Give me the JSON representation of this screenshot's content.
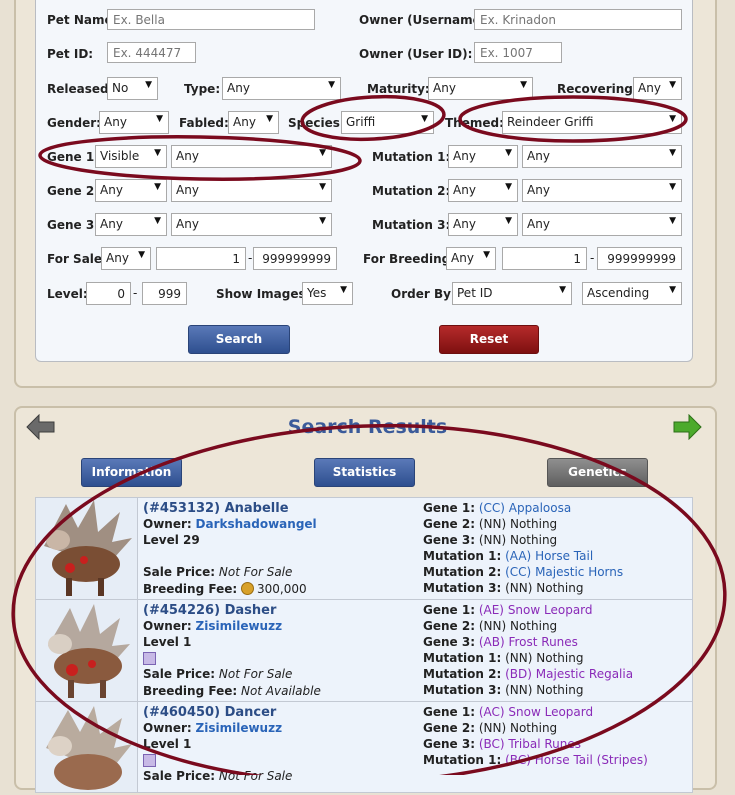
{
  "search_form": {
    "pet_name": {
      "label": "Pet Name:",
      "placeholder": "Ex. Bella"
    },
    "owner_username": {
      "label": "Owner (Username):",
      "placeholder": "Ex. Krinadon"
    },
    "pet_id": {
      "label": "Pet ID:",
      "placeholder": "Ex. 444477"
    },
    "owner_user_id": {
      "label": "Owner (User ID):",
      "placeholder": "Ex. 1007"
    },
    "released": {
      "label": "Released:",
      "value": "No"
    },
    "type": {
      "label": "Type:",
      "value": "Any"
    },
    "maturity": {
      "label": "Maturity:",
      "value": "Any"
    },
    "recovering": {
      "label": "Recovering:",
      "value": "Any"
    },
    "gender": {
      "label": "Gender:",
      "value": "Any"
    },
    "fabled": {
      "label": "Fabled:",
      "value": "Any"
    },
    "species": {
      "label": "Species:",
      "value": "Griffi"
    },
    "themed": {
      "label": "Themed:",
      "value": "Reindeer Griffi"
    },
    "gene1": {
      "label": "Gene 1:",
      "mode": "Visible",
      "value": "Any"
    },
    "gene2": {
      "label": "Gene 2:",
      "mode": "Any",
      "value": "Any"
    },
    "gene3": {
      "label": "Gene 3:",
      "mode": "Any",
      "value": "Any"
    },
    "mutation1": {
      "label": "Mutation 1:",
      "mode": "Any",
      "value": "Any"
    },
    "mutation2": {
      "label": "Mutation 2:",
      "mode": "Any",
      "value": "Any"
    },
    "mutation3": {
      "label": "Mutation 3:",
      "mode": "Any",
      "value": "Any"
    },
    "for_sale": {
      "label": "For Sale:",
      "mode": "Any",
      "min": "1",
      "max": "999999999"
    },
    "for_breeding": {
      "label": "For Breeding:",
      "mode": "Any",
      "min": "1",
      "max": "999999999"
    },
    "level": {
      "label": "Level:",
      "min": "0",
      "max": "999"
    },
    "show_images": {
      "label": "Show Images:",
      "value": "Yes"
    },
    "order_by": {
      "label": "Order By:",
      "value": "Pet ID",
      "direction": "Ascending"
    },
    "dash": "-",
    "search_button": "Search",
    "reset_button": "Reset"
  },
  "results": {
    "title": "Search Results",
    "tabs": [
      "Information",
      "Statistics",
      "Genetics"
    ],
    "pets": [
      {
        "id_name": "(#453132) Anabelle",
        "owner_label": "Owner:",
        "owner": "Darkshadowangel",
        "level": "Level 29",
        "sale_label": "Sale Price:",
        "sale": "Not For Sale",
        "breed_label": "Breeding Fee:",
        "breed": "300,000",
        "genes": [
          {
            "label": "Gene 1:",
            "code": "(CC)",
            "name": "Appaloosa",
            "color": "blue"
          },
          {
            "label": "Gene 2:",
            "code": "(NN)",
            "name": "Nothing",
            "color": "plain"
          },
          {
            "label": "Gene 3:",
            "code": "(NN)",
            "name": "Nothing",
            "color": "plain"
          },
          {
            "label": "Mutation 1:",
            "code": "(AA)",
            "name": "Horse Tail",
            "color": "blue"
          },
          {
            "label": "Mutation 2:",
            "code": "(CC)",
            "name": "Majestic Horns",
            "color": "blue"
          },
          {
            "label": "Mutation 3:",
            "code": "(NN)",
            "name": "Nothing",
            "color": "plain"
          }
        ]
      },
      {
        "id_name": "(#454226) Dasher",
        "owner_label": "Owner:",
        "owner": "Zisimilewuzz",
        "level": "Level 1",
        "sale_label": "Sale Price:",
        "sale": "Not For Sale",
        "breed_label": "Breeding Fee:",
        "breed": "Not Available",
        "genes": [
          {
            "label": "Gene 1:",
            "code": "(AE)",
            "name": "Snow Leopard",
            "color": "purple"
          },
          {
            "label": "Gene 2:",
            "code": "(NN)",
            "name": "Nothing",
            "color": "plain"
          },
          {
            "label": "Gene 3:",
            "code": "(AB)",
            "name": "Frost Runes",
            "color": "purple"
          },
          {
            "label": "Mutation 1:",
            "code": "(NN)",
            "name": "Nothing",
            "color": "plain"
          },
          {
            "label": "Mutation 2:",
            "code": "(BD)",
            "name": "Majestic Regalia",
            "color": "purple"
          },
          {
            "label": "Mutation 3:",
            "code": "(NN)",
            "name": "Nothing",
            "color": "plain"
          }
        ]
      },
      {
        "id_name": "(#460450) Dancer",
        "owner_label": "Owner:",
        "owner": "Zisimilewuzz",
        "level": "Level 1",
        "sale_label": "Sale Price:",
        "sale": "Not For Sale",
        "genes": [
          {
            "label": "Gene 1:",
            "code": "(AC)",
            "name": "Snow Leopard",
            "color": "purple"
          },
          {
            "label": "Gene 2:",
            "code": "(NN)",
            "name": "Nothing",
            "color": "plain"
          },
          {
            "label": "Gene 3:",
            "code": "(BC)",
            "name": "Tribal Runes",
            "color": "purple"
          },
          {
            "label": "Mutation 1:",
            "code": "(BC)",
            "name": "Horse Tail (Stripes)",
            "color": "purple"
          }
        ]
      }
    ]
  },
  "colors": {
    "annotation": "#7a0a1e",
    "blue_link": "#2a64b8",
    "purple_gene": "#8a2bb8",
    "title": "#3b5b9a"
  }
}
